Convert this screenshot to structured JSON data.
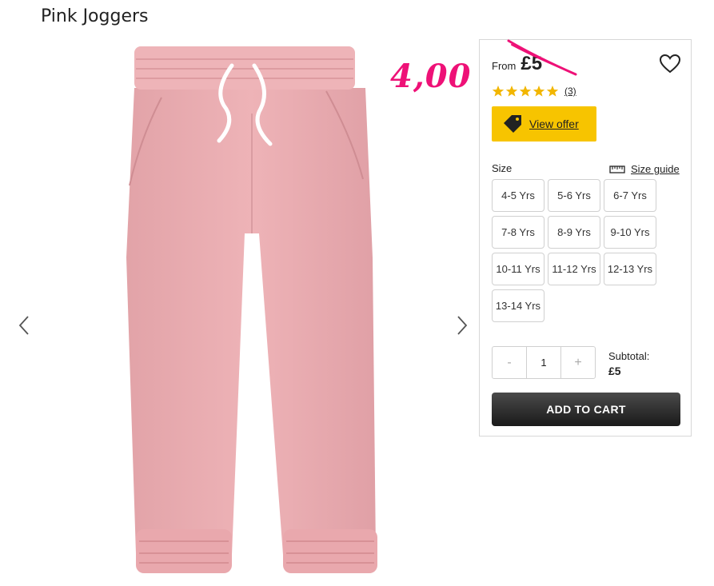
{
  "product": {
    "title": "Pink Joggers",
    "handwritten_price": "4,00",
    "from_label": "From",
    "old_price": "£5",
    "rating": {
      "stars": 5,
      "count_label": "(3)"
    },
    "offer_label": "View offer",
    "size_label": "Size",
    "size_guide_label": "Size guide",
    "sizes": [
      "4-5 Yrs",
      "5-6 Yrs",
      "6-7 Yrs",
      "7-8 Yrs",
      "8-9 Yrs",
      "9-10 Yrs",
      "10-11 Yrs",
      "11-12 Yrs",
      "12-13 Yrs",
      "13-14 Yrs"
    ],
    "quantity": {
      "minus": "-",
      "value": "1",
      "plus": "+"
    },
    "subtotal_label": "Subtotal:",
    "subtotal_value": "£5",
    "add_to_cart_label": "ADD TO CART"
  },
  "icons": {
    "prev": "chevron-left-icon",
    "next": "chevron-right-icon",
    "wishlist": "heart-icon",
    "offer": "tag-icon",
    "size_guide": "ruler-icon",
    "rating": "star-icon"
  },
  "colors": {
    "accent_yellow": "#f7c400",
    "annotation_pink": "#ee1177",
    "star_gold": "#f2b600",
    "garment_pink": "#e8a9ae"
  }
}
